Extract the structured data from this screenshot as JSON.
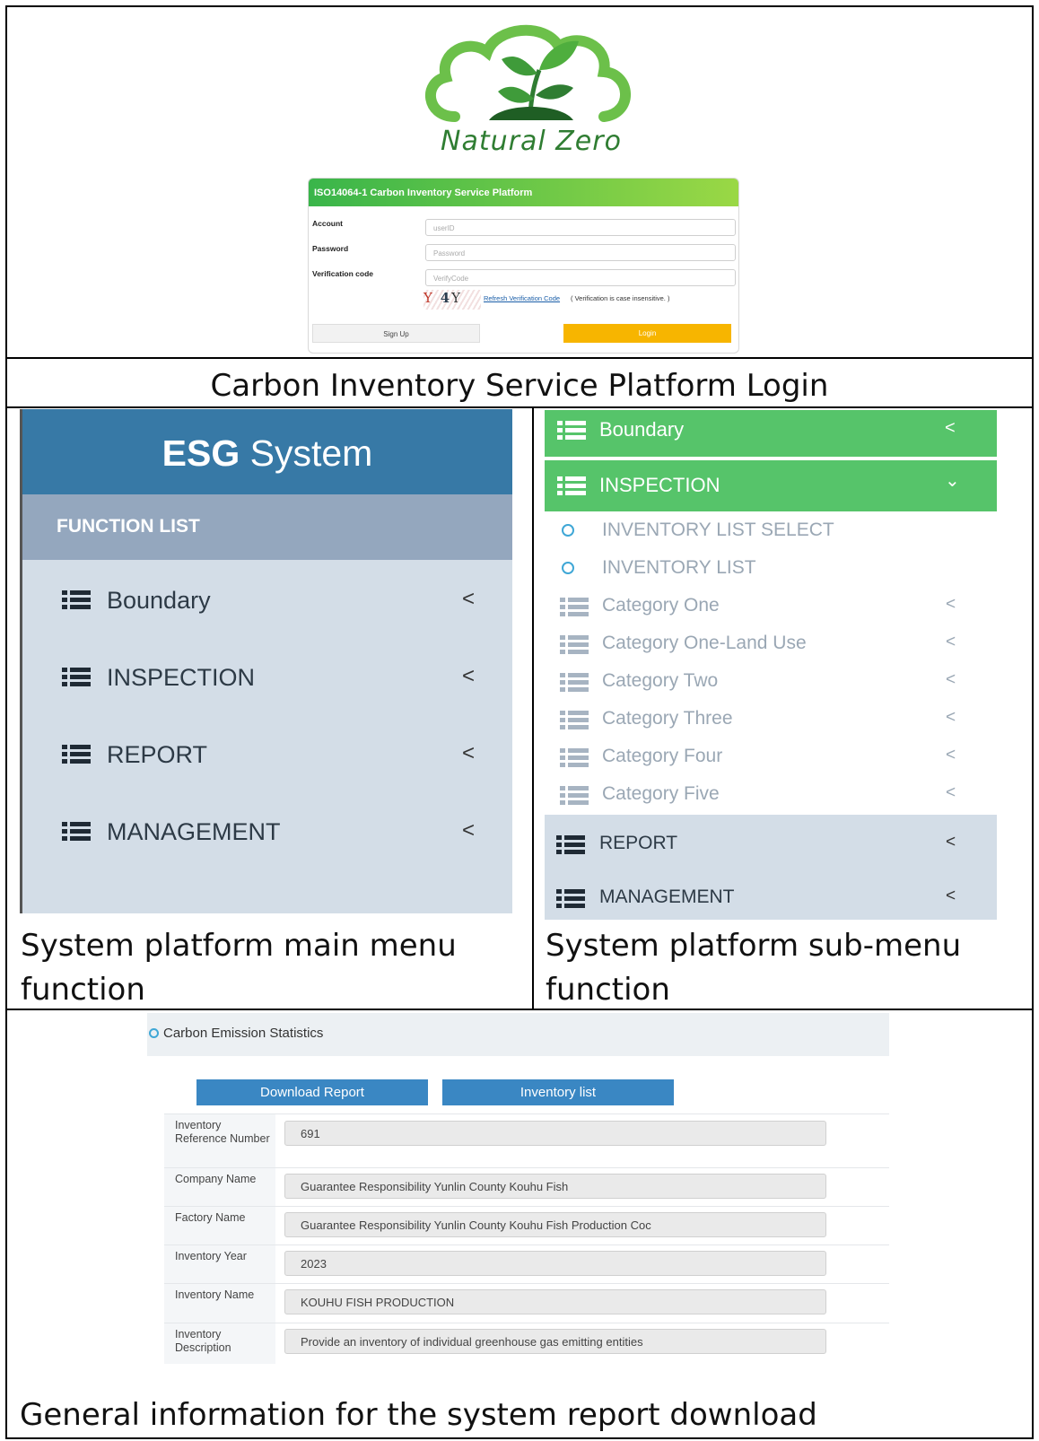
{
  "login": {
    "brand": "Natural Zero",
    "card_title": "ISO14064-1 Carbon Inventory Service Platform",
    "account_label": "Account",
    "account_placeholder": "userID",
    "password_label": "Password",
    "password_placeholder": "Password",
    "verify_label": "Verification code",
    "verify_placeholder": "VerifyCode",
    "captcha_chars": [
      "Y",
      "4",
      "Y"
    ],
    "refresh_link": "Refresh Verification Code",
    "case_note": "( Verification is case insensitive. )",
    "signup_button": "Sign Up",
    "login_button": "Login",
    "colors": {
      "header_start": "#39b54a",
      "header_end": "#9ad845",
      "login_button": "#f7b500"
    }
  },
  "captions": {
    "login": "Carbon Inventory Service Platform Login",
    "main_menu": "System platform main menu function",
    "sub_menu": "System platform sub-menu function",
    "report": "General information for the system report download"
  },
  "main_menu": {
    "title_bold": "ESG",
    "title_rest": "System",
    "section_label": "FUNCTION LIST",
    "items": [
      {
        "label": "Boundary",
        "icon": "list-icon",
        "chevron": "<"
      },
      {
        "label": "INSPECTION",
        "icon": "list-icon",
        "chevron": "<"
      },
      {
        "label": "REPORT",
        "icon": "list-icon",
        "chevron": "<"
      },
      {
        "label": "MANAGEMENT",
        "icon": "list-icon",
        "chevron": "<"
      }
    ],
    "colors": {
      "header": "#3779a6",
      "section": "#94a7be",
      "body": "#d3dde7"
    }
  },
  "sub_menu": {
    "top_items": [
      {
        "label": "Boundary",
        "chevron": "<"
      },
      {
        "label": "INSPECTION",
        "chevron": "⌄"
      }
    ],
    "children": [
      {
        "label": "INVENTORY LIST SELECT",
        "icon": "circle-icon",
        "chevron": ""
      },
      {
        "label": "INVENTORY LIST",
        "icon": "circle-icon",
        "chevron": ""
      },
      {
        "label": "Category One",
        "icon": "list-icon",
        "chevron": "<"
      },
      {
        "label": "Category One-Land Use",
        "icon": "list-icon",
        "chevron": "<"
      },
      {
        "label": "Category Two",
        "icon": "list-icon",
        "chevron": "<"
      },
      {
        "label": "Category Three",
        "icon": "list-icon",
        "chevron": "<"
      },
      {
        "label": "Category Four",
        "icon": "list-icon",
        "chevron": "<"
      },
      {
        "label": "Category Five",
        "icon": "list-icon",
        "chevron": "<"
      }
    ],
    "bottom_items": [
      {
        "label": "REPORT",
        "chevron": "<"
      },
      {
        "label": "MANAGEMENT",
        "chevron": "<"
      }
    ],
    "colors": {
      "active": "#56c46a",
      "inactive": "#d3dde7"
    }
  },
  "report": {
    "header": "Carbon Emission Statistics",
    "buttons": [
      "Download Report",
      "Inventory list"
    ],
    "fields": [
      {
        "label": "Inventory Reference Number",
        "value": "691"
      },
      {
        "label": "Company Name",
        "value": "Guarantee Responsibility Yunlin County Kouhu Fish"
      },
      {
        "label": "Factory Name",
        "value": "Guarantee Responsibility Yunlin County Kouhu Fish Production Coc"
      },
      {
        "label": "Inventory Year",
        "value": "2023"
      },
      {
        "label": "Inventory Name",
        "value": "KOUHU FISH PRODUCTION"
      },
      {
        "label": "Inventory Description",
        "value": "Provide an inventory of individual greenhouse gas emitting entities"
      }
    ],
    "colors": {
      "button": "#3a87c3"
    }
  }
}
